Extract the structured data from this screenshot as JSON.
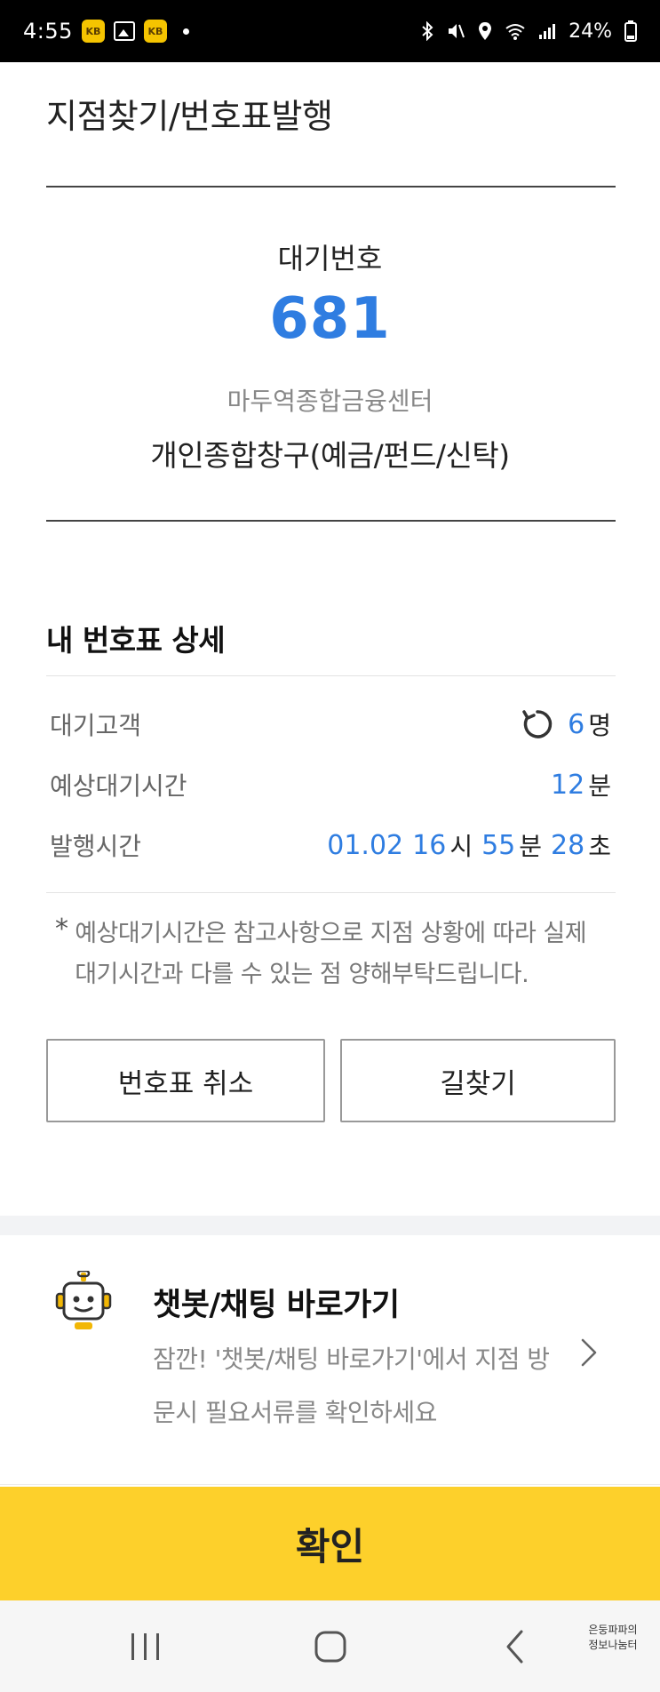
{
  "status_bar": {
    "time": "4:55",
    "app_badge": "KB",
    "battery": "24%"
  },
  "header": {
    "title": "지점찾기/번호표발행"
  },
  "ticket": {
    "label": "대기번호",
    "number": "681",
    "branch": "마두역종합금융센터",
    "counter": "개인종합창구(예금/펀드/신탁)"
  },
  "details": {
    "title": "내 번호표 상세",
    "waiting_customers": {
      "label": "대기고객",
      "value": "6",
      "unit": "명"
    },
    "expected_wait": {
      "label": "예상대기시간",
      "value": "12",
      "unit": "분"
    },
    "issued_time": {
      "label": "발행시간",
      "date": "01.02",
      "hour": "16",
      "hour_unit": "시",
      "minute": "55",
      "minute_unit": "분",
      "second": "28",
      "second_unit": "초"
    },
    "notice_mark": "*",
    "notice": "예상대기시간은 참고사항으로 지점 상황에 따라 실제 대기시간과 다를 수 있는 점 양해부탁드립니다."
  },
  "buttons": {
    "cancel": "번호표 취소",
    "directions": "길찾기"
  },
  "chatbot": {
    "title": "챗봇/채팅 바로가기",
    "description": "잠깐! '챗봇/채팅 바로가기'에서 지점 방문시 필요서류를 확인하세요"
  },
  "confirm_label": "확인",
  "watermark": {
    "line1": "은둥파파의",
    "line2": "정보나눔터"
  },
  "colors": {
    "accent_blue": "#2f7de1",
    "confirm_yellow": "#fdd02b"
  }
}
